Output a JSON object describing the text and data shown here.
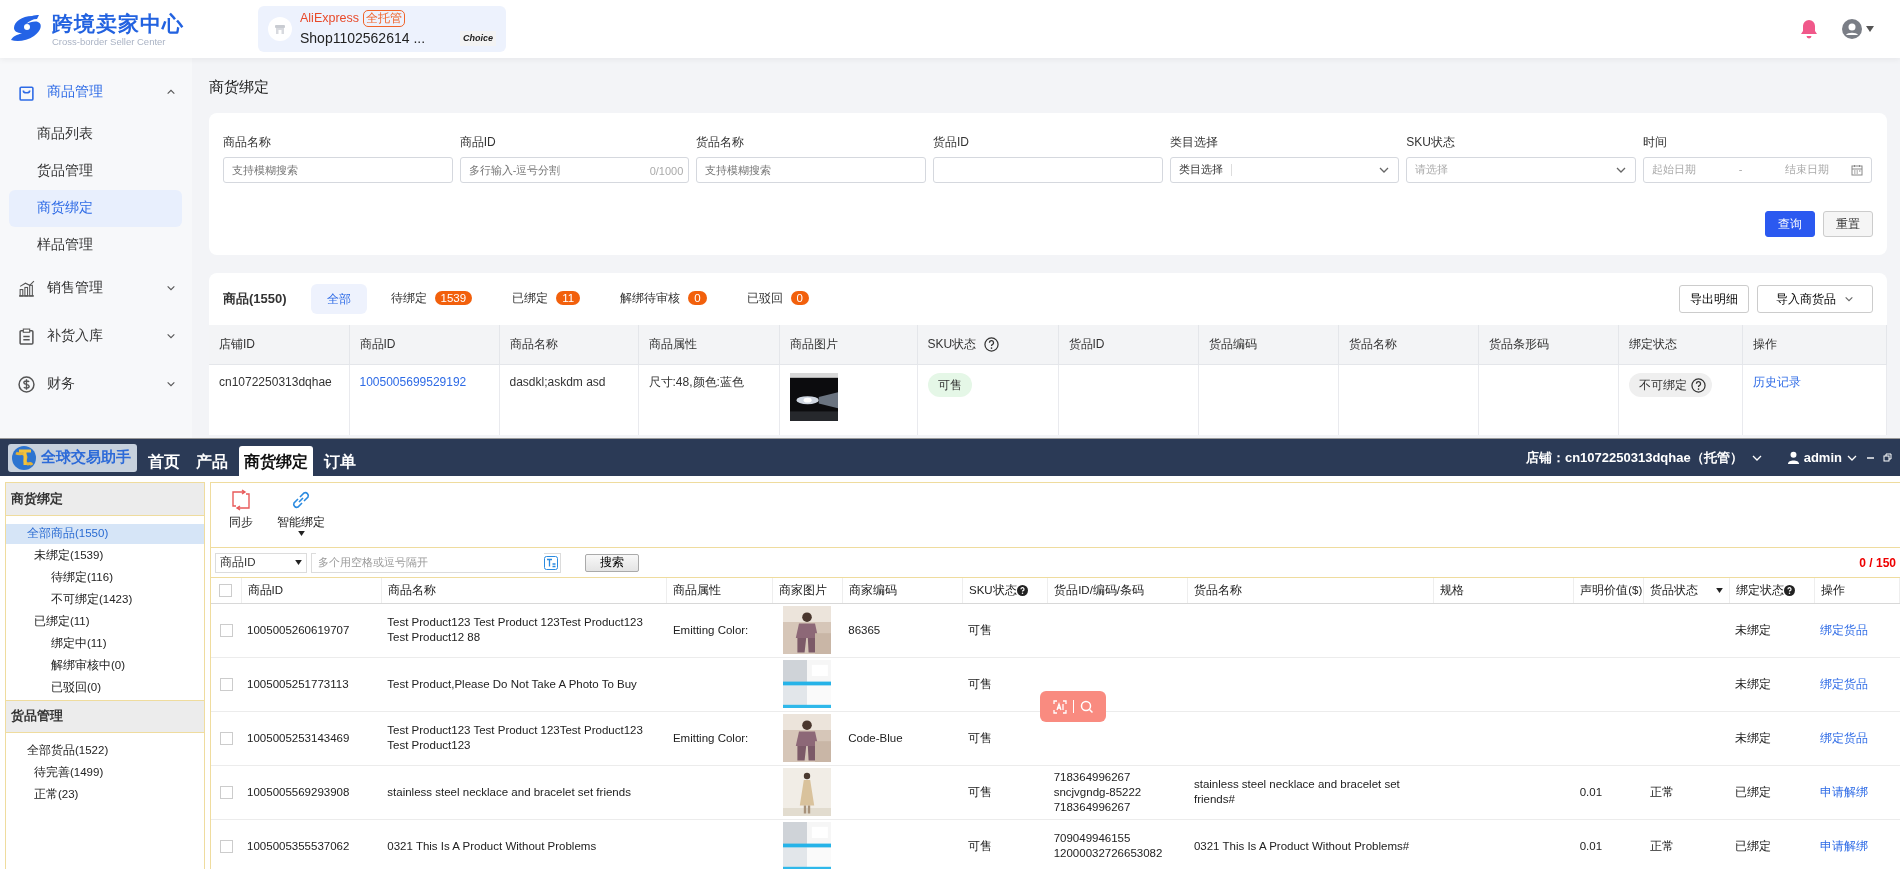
{
  "header": {
    "title": "跨境卖家中心",
    "subtitle": "Cross-border Seller Center",
    "shop": {
      "platform": "AliExpress",
      "badge": "全托管",
      "name": "Shop1102562614 ...",
      "tag": "Choice"
    }
  },
  "sidebar": [
    {
      "label": "商品管理",
      "expanded": true,
      "children": [
        {
          "label": "商品列表",
          "selected": false
        },
        {
          "label": "货品管理",
          "selected": false
        },
        {
          "label": "商货绑定",
          "selected": true
        },
        {
          "label": "样品管理",
          "selected": false
        }
      ]
    },
    {
      "label": "销售管理",
      "expanded": false
    },
    {
      "label": "补货入库",
      "expanded": false
    },
    {
      "label": "财务",
      "expanded": false
    }
  ],
  "page_title": "商货绑定",
  "filters": [
    {
      "label": "商品名称",
      "kind": "text",
      "placeholder": "支持模糊搜索"
    },
    {
      "label": "商品ID",
      "kind": "text",
      "placeholder": "多行输入-逗号分割",
      "counter": "0/1000"
    },
    {
      "label": "货品名称",
      "kind": "text",
      "placeholder": "支持模糊搜索"
    },
    {
      "label": "货品ID",
      "kind": "text"
    },
    {
      "label": "类目选择",
      "kind": "select",
      "prefix": "类目选择"
    },
    {
      "label": "SKU状态",
      "kind": "select",
      "placeholder": "请选择"
    },
    {
      "label": "时间",
      "kind": "daterange",
      "start": "起始日期",
      "separator": "-",
      "end": "结束日期"
    }
  ],
  "filter_buttons": [
    {
      "label": "查询",
      "kind": "primary"
    },
    {
      "label": "重置",
      "kind": "secondary"
    }
  ],
  "products": {
    "title": "商品(1550)",
    "tabs": [
      {
        "label": "全部",
        "selected": true
      },
      {
        "label": "待绑定",
        "count": "1539",
        "selected": false
      },
      {
        "label": "已绑定",
        "count": "11",
        "selected": false
      },
      {
        "label": "解绑待审核",
        "count": "0",
        "selected": false
      },
      {
        "label": "已驳回",
        "count": "0",
        "selected": false
      }
    ],
    "actions": [
      {
        "label": "导出明细"
      },
      {
        "label": "导入商货品",
        "dropdown": true
      }
    ],
    "columns": [
      {
        "label": "店铺ID"
      },
      {
        "label": "商品ID"
      },
      {
        "label": "商品名称"
      },
      {
        "label": "商品属性"
      },
      {
        "label": "商品图片"
      },
      {
        "label": "SKU状态",
        "help": true
      },
      {
        "label": "货品ID"
      },
      {
        "label": "货品编码"
      },
      {
        "label": "货品名称"
      },
      {
        "label": "货品条形码"
      },
      {
        "label": "绑定状态"
      },
      {
        "label": "操作"
      }
    ],
    "rows": [
      {
        "shop_id": "cn1072250313dqhae",
        "product_id": "1005005699529192",
        "name": "dasdkl;askdm asd",
        "attributes": "尺寸:48,颜色:蓝色",
        "image": {
          "kind": "picture"
        },
        "sku_status": "可售",
        "bind_status": "不可绑定",
        "bind_help": true,
        "action": "历史记录"
      }
    ]
  },
  "app": {
    "logo": "全球交易助手",
    "tabs": [
      {
        "label": "首页",
        "selected": false
      },
      {
        "label": "产品",
        "selected": false
      },
      {
        "label": "商货绑定",
        "selected": true
      },
      {
        "label": "订单",
        "selected": false
      }
    ],
    "store": "店铺：cn1072250313dqhae（托管）",
    "user": "admin",
    "tree": [
      {
        "section": "商货绑定",
        "items": [
          {
            "label": "全部商品(1550)",
            "selected": true,
            "children": [
              {
                "label": "未绑定(1539)",
                "selected": false,
                "children": [
                  {
                    "label": "待绑定(116)",
                    "selected": false
                  },
                  {
                    "label": "不可绑定(1423)",
                    "selected": false
                  }
                ]
              },
              {
                "label": "已绑定(11)",
                "selected": false,
                "children": [
                  {
                    "label": "绑定中(11)",
                    "selected": false
                  },
                  {
                    "label": "解绑审核中(0)",
                    "selected": false
                  },
                  {
                    "label": "已驳回(0)",
                    "selected": false
                  }
                ]
              }
            ]
          }
        ]
      },
      {
        "section": "货品管理",
        "items": [
          {
            "label": "全部货品(1522)",
            "selected": false,
            "children": [
              {
                "label": "待完善(1499)",
                "selected": false
              },
              {
                "label": "正常(23)",
                "selected": false
              }
            ]
          }
        ]
      }
    ],
    "toolbar": [
      {
        "label": "同步",
        "kind": "sync"
      },
      {
        "label": "智能绑定",
        "kind": "link",
        "dropdown": true
      }
    ],
    "search": {
      "field": "商品ID",
      "placeholder": "多个用空格或逗号隔开",
      "button": "搜索",
      "counter": "0 / 150"
    },
    "header_checked": false,
    "columns": [
      {
        "label": "商品ID"
      },
      {
        "label": "商品名称"
      },
      {
        "label": "商品属性"
      },
      {
        "label": "商家图片"
      },
      {
        "label": "商家编码"
      },
      {
        "label": "SKU状态",
        "help": true
      },
      {
        "label": "货品ID/编码/条码"
      },
      {
        "label": "货品名称"
      },
      {
        "label": "规格"
      },
      {
        "label": "声明价值($)"
      },
      {
        "label": "货品状态",
        "filter": true
      },
      {
        "label": "绑定状态",
        "help": true
      },
      {
        "label": "操作"
      }
    ],
    "rows": [
      {
        "checked": false,
        "product_id": "1005005260619707",
        "name": "Test Product123 Test Product 123Test Product123 Test Product12 88",
        "attributes": "Emitting Color:",
        "image": {
          "kind": "picture"
        },
        "merchant_code": "86365",
        "sku_status": "可售",
        "bind_status": "未绑定",
        "action": "绑定货品"
      },
      {
        "checked": false,
        "product_id": "1005005251773113",
        "name": "Test Product,Please Do Not Take A Photo To Buy",
        "image": {
          "kind": "picture"
        },
        "sku_status": "可售",
        "bind_status": "未绑定",
        "action": "绑定货品"
      },
      {
        "checked": false,
        "product_id": "1005005253143469",
        "name": "Test Product123 Test Product 123Test Product123 Test Product123",
        "attributes": "Emitting Color:",
        "image": {
          "kind": "picture"
        },
        "merchant_code": "Code-Blue",
        "sku_status": "可售",
        "bind_status": "未绑定",
        "action": "绑定货品"
      },
      {
        "checked": false,
        "product_id": "1005005569293908",
        "name": "stainless steel necklace and bracelet set friends",
        "image": {
          "kind": "picture"
        },
        "sku_status": "可售",
        "goods_codes": [
          "718364996267",
          "sncjvgndg-85222",
          "718364996267"
        ],
        "goods_name": "stainless steel necklace and bracelet set friends#",
        "value": "0.01",
        "goods_status": "正常",
        "bind_status": "已绑定",
        "action": "申请解绑"
      },
      {
        "checked": false,
        "product_id": "1005005355537062",
        "name": "0321 This Is A Product Without Problems",
        "image": {
          "kind": "picture"
        },
        "sku_status": "可售",
        "goods_codes": [
          "709049946155",
          "12000032726653082"
        ],
        "goods_name": "0321 This Is A Product Without Problems#",
        "value": "0.01",
        "goods_status": "正常",
        "bind_status": "已绑定",
        "action": "申请解绑"
      }
    ]
  }
}
